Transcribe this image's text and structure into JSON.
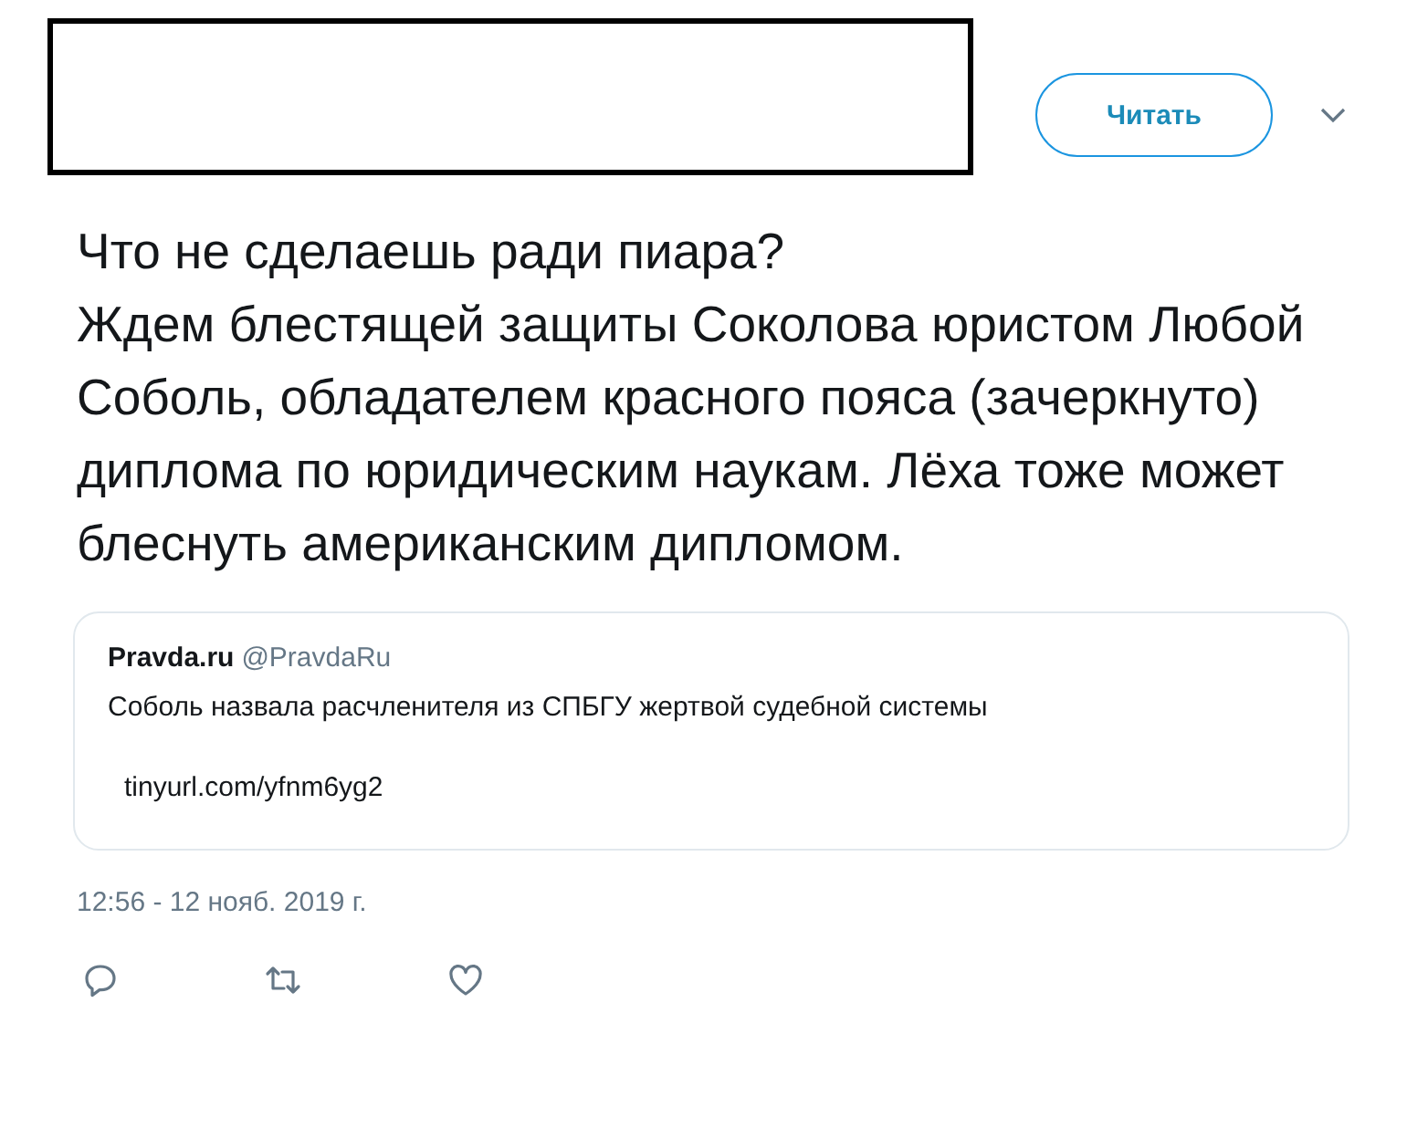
{
  "header": {
    "follow_button": "Читать"
  },
  "tweet": {
    "text": "Что не сделаешь ради пиара?\nЖдем блестящей защиты Соколова юристом Любой Соболь, обладателем красного пояса (зачеркнуто) диплома по юридическим наукам. Лёха тоже может блеснуть американским дипломом."
  },
  "quote": {
    "name": "Pravda.ru",
    "handle": "@PravdaRu",
    "text": "Соболь назвала расчленителя из СПБГУ жертвой судебной системы",
    "link": "tinyurl.com/yfnm6yg2"
  },
  "timestamp": "12:56 - 12 нояб. 2019 г.",
  "actions": [
    {
      "kind": "reply"
    },
    {
      "kind": "retweet"
    },
    {
      "kind": "like"
    }
  ]
}
